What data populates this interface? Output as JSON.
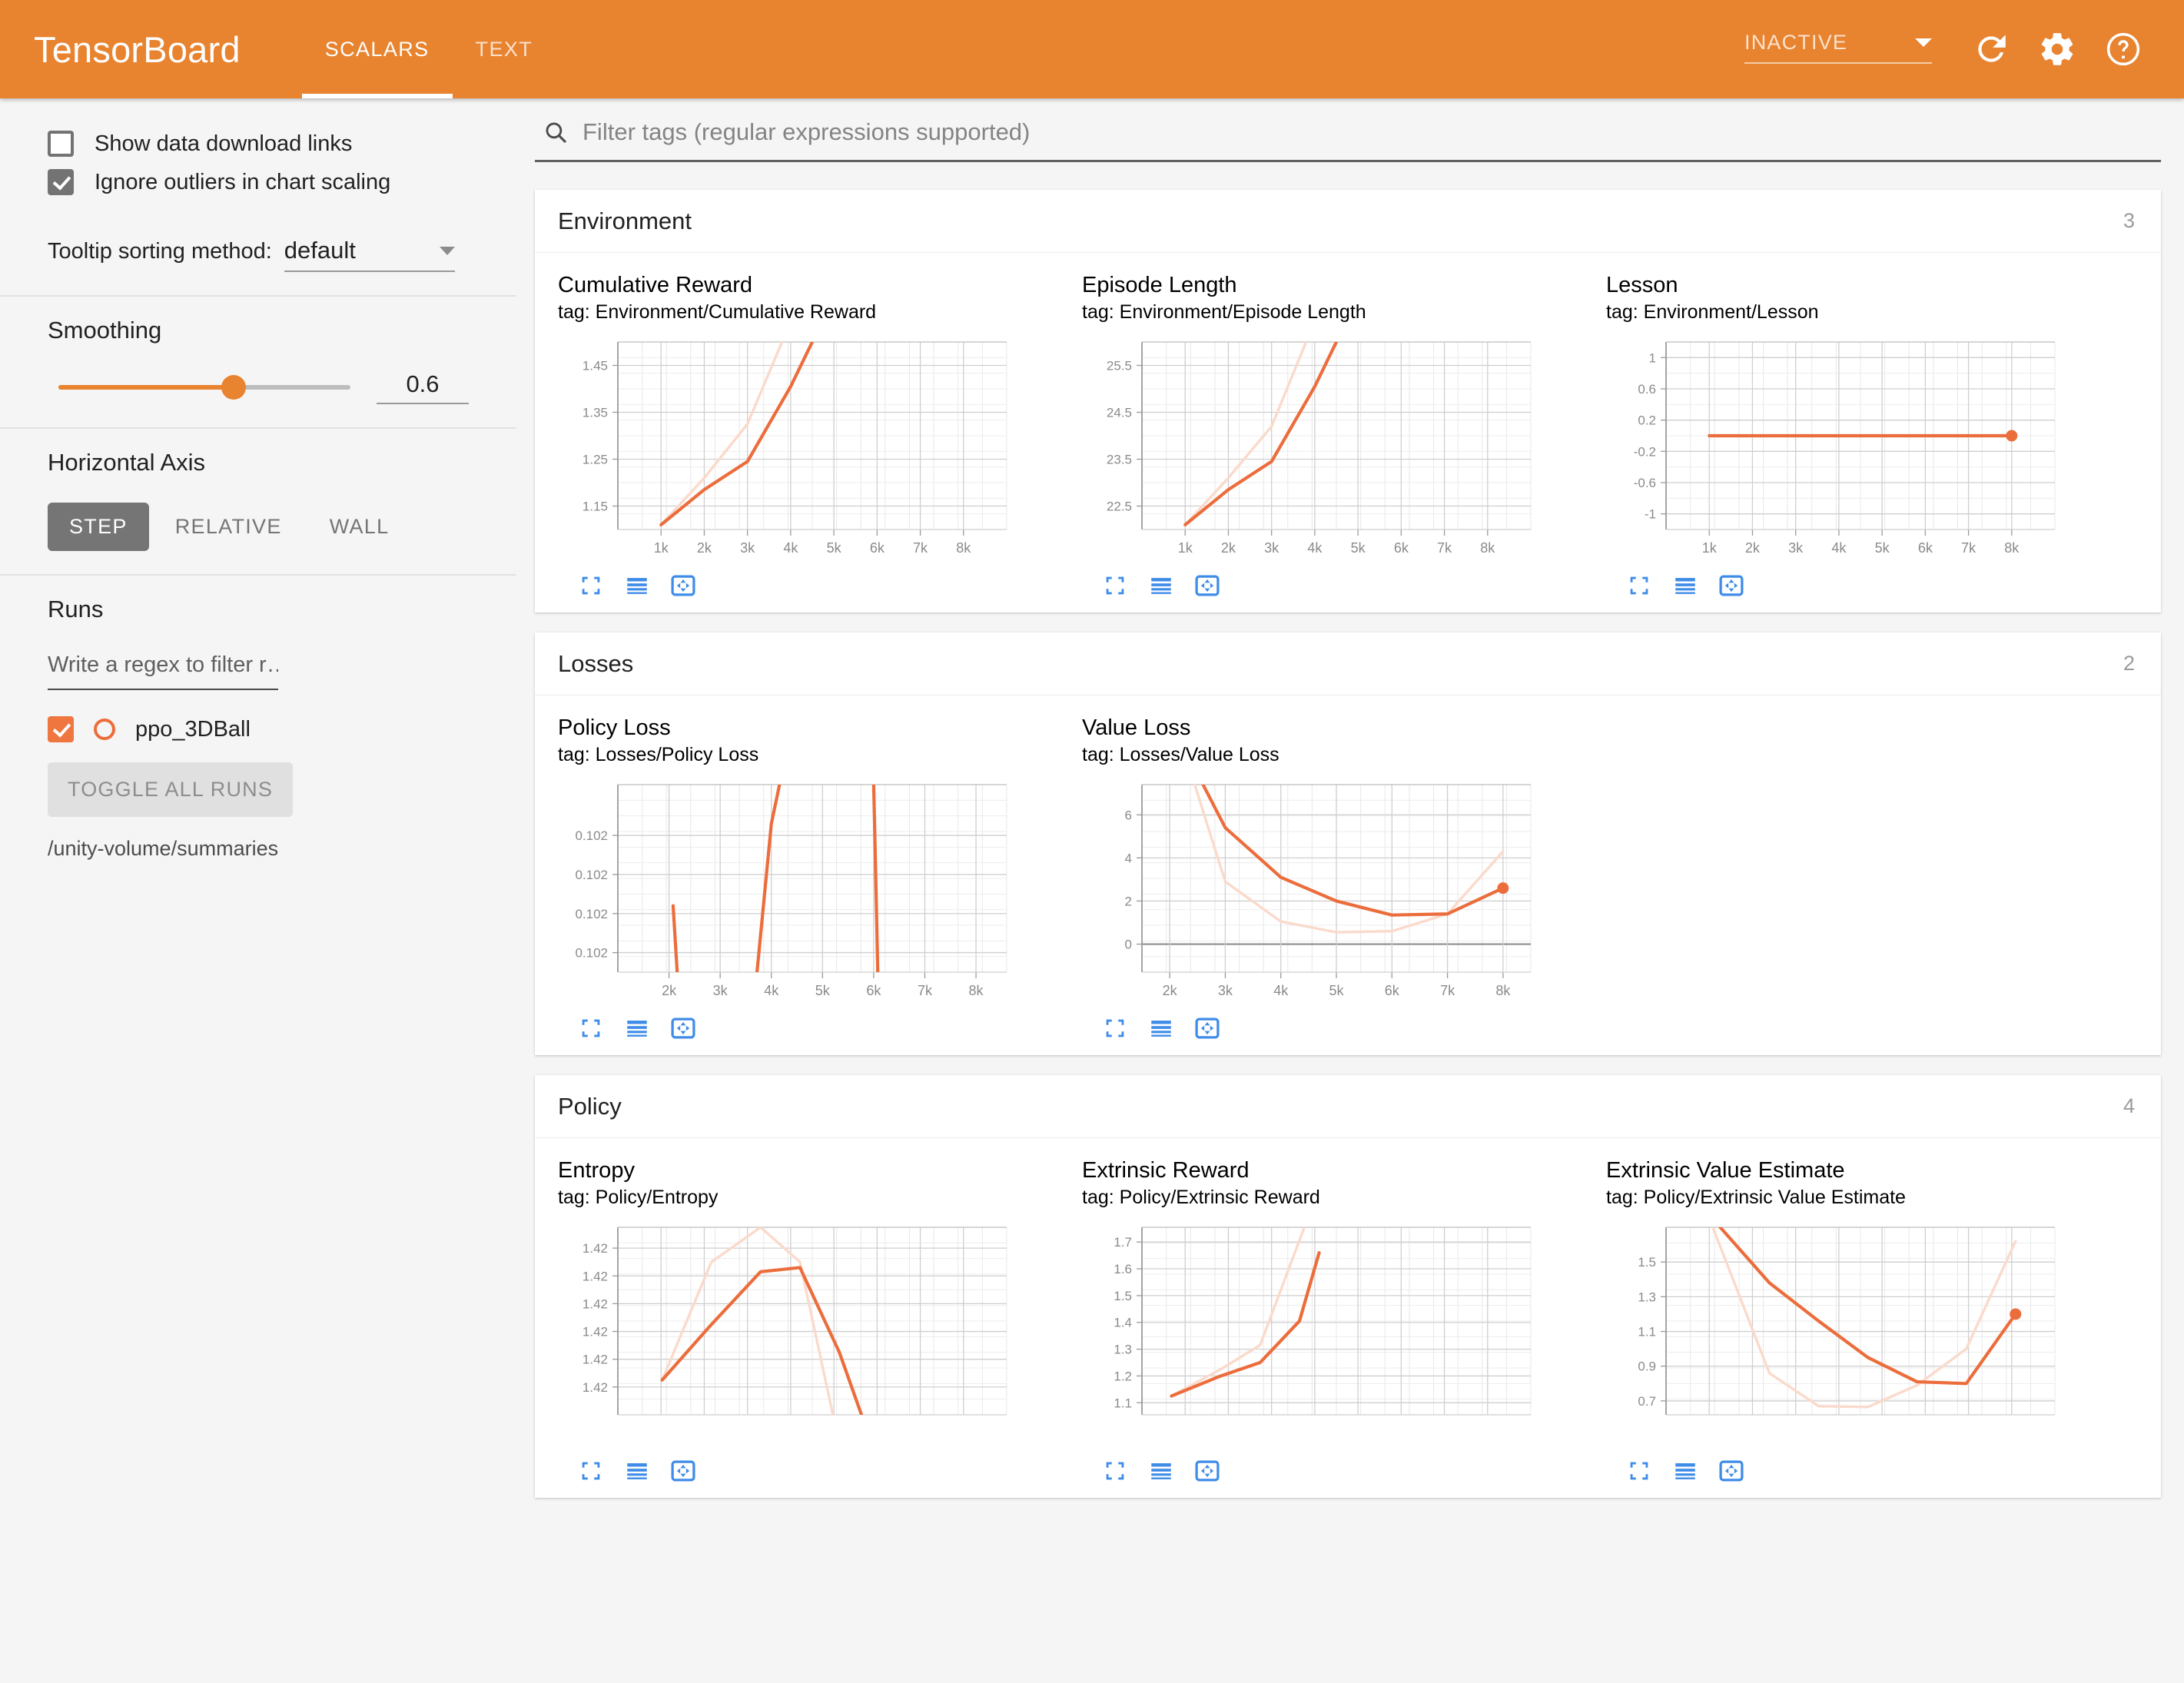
{
  "header": {
    "brand": "TensorBoard",
    "tabs": [
      {
        "label": "SCALARS",
        "active": true
      },
      {
        "label": "TEXT",
        "active": false
      }
    ],
    "run_status": "INACTIVE",
    "icons": [
      "refresh-icon",
      "gear-icon",
      "help-icon"
    ]
  },
  "sidebar": {
    "show_download_links_label": "Show data download links",
    "show_download_links_checked": false,
    "ignore_outliers_label": "Ignore outliers in chart scaling",
    "ignore_outliers_checked": true,
    "tooltip_sorting_label": "Tooltip sorting method:",
    "tooltip_sorting_value": "default",
    "smoothing_label": "Smoothing",
    "smoothing_value": "0.6",
    "horizontal_axis_label": "Horizontal Axis",
    "axis_options": [
      {
        "label": "STEP",
        "active": true
      },
      {
        "label": "RELATIVE",
        "active": false
      },
      {
        "label": "WALL",
        "active": false
      }
    ],
    "runs_label": "Runs",
    "runs_filter_placeholder": "Write a regex to filter r…",
    "runs_filter_value": "",
    "runs": [
      {
        "name": "ppo_3DBall",
        "checked": true,
        "color": "#ec6d3c"
      }
    ],
    "toggle_all_runs_label": "TOGGLE ALL RUNS",
    "summaries_path": "/unity-volume/summaries"
  },
  "search": {
    "placeholder": "Filter tags (regular expressions supported)",
    "value": ""
  },
  "colors": {
    "brand_orange": "#e8832f",
    "series_main": "#ec6d3c",
    "series_faded": "#fadacb",
    "tool_blue": "#3f8ce8",
    "grid": "#d6d6d6",
    "axis": "#888888"
  },
  "chart_tools": [
    "expand-icon",
    "lines-icon",
    "pan-icon"
  ],
  "sections": [
    {
      "title": "Environment",
      "count": "3",
      "charts": [
        "cumulative_reward",
        "episode_length",
        "lesson"
      ]
    },
    {
      "title": "Losses",
      "count": "2",
      "charts": [
        "policy_loss",
        "value_loss"
      ]
    },
    {
      "title": "Policy",
      "count": "4",
      "charts": [
        "entropy",
        "extrinsic_reward",
        "extrinsic_value_estimate"
      ]
    }
  ],
  "chart_data": [
    {
      "id": "cumulative_reward",
      "type": "line",
      "title": "Cumulative Reward",
      "tag_text": "tag: Environment/Cumulative Reward",
      "xlabel": "",
      "ylabel": "",
      "grid": true,
      "legend": "none",
      "xticks": [
        "1k",
        "2k",
        "3k",
        "4k",
        "5k",
        "6k",
        "7k",
        "8k"
      ],
      "yticks": [
        "1.15",
        "1.25",
        "1.35",
        "1.45"
      ],
      "ytick_values": [
        1.15,
        1.25,
        1.35,
        1.45
      ],
      "xlim": [
        0,
        9000
      ],
      "ylim": [
        1.1,
        1.5
      ],
      "series": [
        {
          "name": "ppo_3DBall (smoothed)",
          "style": "solid",
          "x": [
            1000,
            2000,
            3000,
            4000,
            4500
          ],
          "values": [
            1.11,
            1.185,
            1.245,
            1.405,
            1.5
          ]
        },
        {
          "name": "ppo_3DBall (raw)",
          "style": "faded",
          "x": [
            1000,
            2000,
            3000,
            3800
          ],
          "values": [
            1.11,
            1.21,
            1.325,
            1.5
          ]
        }
      ]
    },
    {
      "id": "episode_length",
      "type": "line",
      "title": "Episode Length",
      "tag_text": "tag: Environment/Episode Length",
      "xlabel": "",
      "ylabel": "",
      "grid": true,
      "legend": "none",
      "xticks": [
        "1k",
        "2k",
        "3k",
        "4k",
        "5k",
        "6k",
        "7k",
        "8k"
      ],
      "yticks": [
        "22.5",
        "23.5",
        "24.5",
        "25.5"
      ],
      "ytick_values": [
        22.5,
        23.5,
        24.5,
        25.5
      ],
      "xlim": [
        0,
        9000
      ],
      "ylim": [
        22.0,
        26.0
      ],
      "series": [
        {
          "name": "ppo_3DBall (smoothed)",
          "style": "solid",
          "x": [
            1000,
            2000,
            3000,
            4000,
            4500
          ],
          "values": [
            22.1,
            22.85,
            23.45,
            25.05,
            26.0
          ]
        },
        {
          "name": "ppo_3DBall (raw)",
          "style": "faded",
          "x": [
            1000,
            2000,
            3000,
            3800
          ],
          "values": [
            22.1,
            23.1,
            24.2,
            26.0
          ]
        }
      ]
    },
    {
      "id": "lesson",
      "type": "line",
      "title": "Lesson",
      "tag_text": "tag: Environment/Lesson",
      "xlabel": "",
      "ylabel": "",
      "grid": true,
      "legend": "none",
      "xticks": [
        "1k",
        "2k",
        "3k",
        "4k",
        "5k",
        "6k",
        "7k",
        "8k"
      ],
      "yticks": [
        "-1",
        "-0.6",
        "-0.2",
        "0.2",
        "0.6",
        "1"
      ],
      "ytick_values": [
        -1,
        -0.6,
        -0.2,
        0.2,
        0.6,
        1
      ],
      "xlim": [
        0,
        9000
      ],
      "ylim": [
        -1.2,
        1.2
      ],
      "marker_last": true,
      "series": [
        {
          "name": "ppo_3DBall (smoothed)",
          "style": "solid",
          "x": [
            1000,
            8000
          ],
          "values": [
            0,
            0
          ]
        }
      ]
    },
    {
      "id": "policy_loss",
      "type": "line",
      "title": "Policy Loss",
      "tag_text": "tag: Losses/Policy Loss",
      "xlabel": "",
      "ylabel": "",
      "grid": true,
      "legend": "none",
      "xticks": [
        "2k",
        "3k",
        "4k",
        "5k",
        "6k",
        "7k",
        "8k"
      ],
      "yticks": [
        "0.102",
        "0.102",
        "0.102",
        "0.102"
      ],
      "ytick_values": [
        0.1021,
        0.1022,
        0.1023,
        0.1024
      ],
      "xlim": [
        1000,
        8600
      ],
      "ylim": [
        0.10205,
        0.10253
      ],
      "series": [
        {
          "name": "ppo_3DBall segment 1",
          "style": "solid",
          "x": [
            2080,
            2160
          ],
          "values": [
            0.10222,
            0.10205
          ]
        },
        {
          "name": "ppo_3DBall segment 2",
          "style": "solid",
          "x": [
            3720,
            4000,
            4160
          ],
          "values": [
            0.10205,
            0.10243,
            0.10253
          ]
        },
        {
          "name": "ppo_3DBall segment 3",
          "style": "solid",
          "x": [
            6080,
            6040,
            6000
          ],
          "values": [
            0.10205,
            0.1023,
            0.10253
          ]
        }
      ]
    },
    {
      "id": "value_loss",
      "type": "line",
      "title": "Value Loss",
      "tag_text": "tag: Losses/Value Loss",
      "xlabel": "",
      "ylabel": "",
      "grid": true,
      "legend": "none",
      "xticks": [
        "2k",
        "3k",
        "4k",
        "5k",
        "6k",
        "7k",
        "8k"
      ],
      "yticks": [
        "0",
        "2",
        "4",
        "6"
      ],
      "ytick_values": [
        0,
        2,
        4,
        6
      ],
      "xlim": [
        1500,
        8500
      ],
      "ylim": [
        -1.3,
        7.4
      ],
      "marker_last": true,
      "series": [
        {
          "name": "ppo_3DBall (smoothed)",
          "style": "solid",
          "x": [
            2600,
            3000,
            4000,
            5000,
            6000,
            7000,
            8000
          ],
          "values": [
            7.4,
            5.4,
            3.1,
            2.0,
            1.35,
            1.4,
            2.6
          ]
        },
        {
          "name": "ppo_3DBall (raw)",
          "style": "faded",
          "x": [
            2450,
            3000,
            4000,
            5000,
            6000,
            7000,
            8000
          ],
          "values": [
            7.4,
            2.9,
            1.05,
            0.55,
            0.6,
            1.4,
            4.3
          ]
        }
      ]
    },
    {
      "id": "entropy",
      "type": "line",
      "title": "Entropy",
      "tag_text": "tag: Policy/Entropy",
      "xlabel": "",
      "ylabel": "",
      "grid": true,
      "legend": "none",
      "xticks": [],
      "yticks": [
        "1.42",
        "1.42",
        "1.42",
        "1.42",
        "1.42",
        "1.42"
      ],
      "ytick_values": [
        1.4195,
        1.4197,
        1.4199,
        1.4201,
        1.4203,
        1.4205
      ],
      "xlim": [
        900,
        8800
      ],
      "ylim": [
        1.4193,
        1.42065
      ],
      "series": [
        {
          "name": "ppo_3DBall (smoothed)",
          "style": "solid",
          "x": [
            1800,
            2800,
            3800,
            4600,
            5400,
            5900
          ],
          "values": [
            1.41955,
            1.41995,
            1.42033,
            1.42036,
            1.41975,
            1.41925
          ]
        },
        {
          "name": "ppo_3DBall (raw)",
          "style": "faded",
          "x": [
            1800,
            2800,
            3800,
            4600,
            5300
          ],
          "values": [
            1.41955,
            1.4204,
            1.42065,
            1.4204,
            1.41925
          ]
        }
      ]
    },
    {
      "id": "extrinsic_reward",
      "type": "line",
      "title": "Extrinsic Reward",
      "tag_text": "tag: Policy/Extrinsic Reward",
      "xlabel": "",
      "ylabel": "",
      "grid": true,
      "legend": "none",
      "xticks": [],
      "yticks": [
        "1.1",
        "1.2",
        "1.3",
        "1.4",
        "1.5",
        "1.6",
        "1.7"
      ],
      "ytick_values": [
        1.1,
        1.2,
        1.3,
        1.4,
        1.5,
        1.6,
        1.7
      ],
      "xlim": [
        900,
        8800
      ],
      "ylim": [
        1.055,
        1.755
      ],
      "series": [
        {
          "name": "ppo_3DBall (smoothed)",
          "style": "solid",
          "x": [
            1500,
            2500,
            3300,
            4100,
            4500
          ],
          "values": [
            1.125,
            1.2,
            1.25,
            1.405,
            1.66
          ]
        },
        {
          "name": "ppo_3DBall (raw)",
          "style": "faded",
          "x": [
            1500,
            2500,
            3300,
            4200
          ],
          "values": [
            1.125,
            1.225,
            1.315,
            1.755
          ]
        }
      ]
    },
    {
      "id": "extrinsic_value_estimate",
      "type": "line",
      "title": "Extrinsic Value Estimate",
      "tag_text": "tag: Policy/Extrinsic Value Estimate",
      "xlabel": "",
      "ylabel": "",
      "grid": true,
      "legend": "none",
      "xticks": [],
      "yticks": [
        "0.7",
        "0.9",
        "1.1",
        "1.3",
        "1.5"
      ],
      "ytick_values": [
        0.7,
        0.9,
        1.1,
        1.3,
        1.5
      ],
      "xlim": [
        900,
        8800
      ],
      "ylim": [
        0.62,
        1.7
      ],
      "marker_last": true,
      "series": [
        {
          "name": "ppo_3DBall (smoothed)",
          "style": "solid",
          "x": [
            2000,
            3000,
            4000,
            5000,
            6000,
            7000,
            8000
          ],
          "values": [
            1.7,
            1.38,
            1.16,
            0.95,
            0.81,
            0.8,
            1.2
          ]
        },
        {
          "name": "ppo_3DBall (raw)",
          "style": "faded",
          "x": [
            1850,
            3000,
            4000,
            5000,
            6000,
            7000,
            8000
          ],
          "values": [
            1.7,
            0.86,
            0.67,
            0.665,
            0.79,
            1.0,
            1.62
          ]
        }
      ]
    }
  ]
}
